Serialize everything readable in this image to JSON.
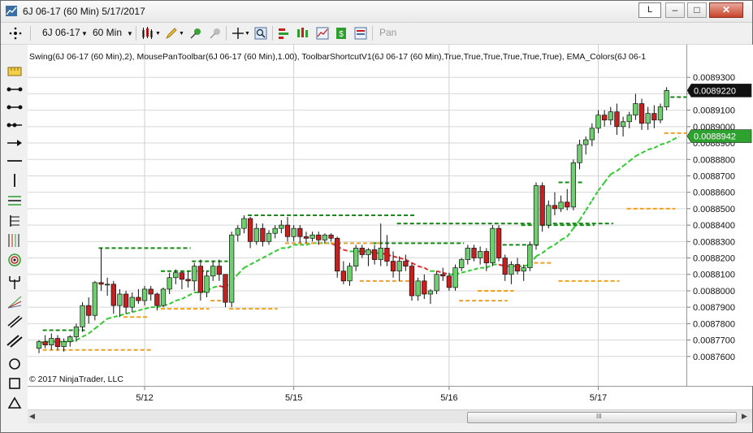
{
  "window": {
    "title": "6J 06-17 (60 Min)  5/17/2017",
    "link_label": "L"
  },
  "toolbar": {
    "instrument": "6J 06-17",
    "interval": "60 Min",
    "pan_label": "Pan"
  },
  "chart_header": {
    "indicators": "Swing(6J 06-17 (60 Min),2), MousePanToolbar(6J 06-17 (60 Min),1.00), ToolbarShortcutV1(6J 06-17 (60 Min),True,True,True,True,True,True), EMA_Colors(6J 06-1"
  },
  "copyright": "© 2017 NinjaTrader, LLC",
  "price_scale": {
    "labels": [
      "0.0089300",
      "0.0089200",
      "0.0089100",
      "0.0089000",
      "0.0088900",
      "0.0088800",
      "0.0088700",
      "0.0088600",
      "0.0088500",
      "0.0088400",
      "0.0088300",
      "0.0088200",
      "0.0088100",
      "0.0088000",
      "0.0087900",
      "0.0087800",
      "0.0087700",
      "0.0087600"
    ],
    "last_price": "0.0089220",
    "ema_value": "0.0088942"
  },
  "time_axis": {
    "labels": [
      "5/12",
      "5/15",
      "5/16",
      "5/17"
    ]
  },
  "colors": {
    "up": "#6fce6f",
    "down": "#c81e1e",
    "ema_up": "#2ecc2e",
    "ema_down": "#e03030",
    "swing_high": "#138b13",
    "swing_low": "#f0a020"
  },
  "chart_data": {
    "type": "candlestick",
    "y_range": [
      0.00875,
      0.00894
    ],
    "bars": [
      [
        0.008765,
        0.00877,
        0.008762,
        0.008769
      ],
      [
        0.008769,
        0.008773,
        0.008765,
        0.008767
      ],
      [
        0.008767,
        0.008774,
        0.008764,
        0.008771
      ],
      [
        0.008771,
        0.008773,
        0.008764,
        0.008766
      ],
      [
        0.008766,
        0.008771,
        0.008763,
        0.008769
      ],
      [
        0.008769,
        0.008773,
        0.008766,
        0.008772
      ],
      [
        0.008772,
        0.00878,
        0.008769,
        0.008778
      ],
      [
        0.008778,
        0.008793,
        0.008775,
        0.008791
      ],
      [
        0.008791,
        0.008796,
        0.00878,
        0.008785
      ],
      [
        0.008785,
        0.008806,
        0.008782,
        0.008805
      ],
      [
        0.008805,
        0.008826,
        0.0088,
        0.008804
      ],
      [
        0.008804,
        0.008808,
        0.008797,
        0.008804
      ],
      [
        0.008804,
        0.008806,
        0.008786,
        0.008791
      ],
      [
        0.008791,
        0.008801,
        0.008784,
        0.008798
      ],
      [
        0.008798,
        0.0088,
        0.008786,
        0.00879
      ],
      [
        0.00879,
        0.008799,
        0.008787,
        0.008796
      ],
      [
        0.008796,
        0.008801,
        0.008792,
        0.008794
      ],
      [
        0.008794,
        0.008803,
        0.008791,
        0.008801
      ],
      [
        0.008801,
        0.008803,
        0.008794,
        0.008798
      ],
      [
        0.008798,
        0.008799,
        0.008788,
        0.008791
      ],
      [
        0.008791,
        0.008802,
        0.00879,
        0.008801
      ],
      [
        0.008801,
        0.008811,
        0.008798,
        0.008808
      ],
      [
        0.008808,
        0.008813,
        0.008804,
        0.008811
      ],
      [
        0.008811,
        0.008812,
        0.008801,
        0.008807
      ],
      [
        0.008807,
        0.008812,
        0.008802,
        0.008806
      ],
      [
        0.008806,
        0.008817,
        0.0088,
        0.008815
      ],
      [
        0.008815,
        0.008819,
        0.008794,
        0.008799
      ],
      [
        0.008799,
        0.008812,
        0.008796,
        0.008809
      ],
      [
        0.008809,
        0.008818,
        0.008806,
        0.008815
      ],
      [
        0.008815,
        0.008819,
        0.008806,
        0.00881
      ],
      [
        0.00881,
        0.00881,
        0.00879,
        0.008793
      ],
      [
        0.008793,
        0.008836,
        0.00879,
        0.008834
      ],
      [
        0.008834,
        0.00884,
        0.00883,
        0.008838
      ],
      [
        0.008838,
        0.008846,
        0.008835,
        0.008844
      ],
      [
        0.008844,
        0.008845,
        0.008826,
        0.00883
      ],
      [
        0.00883,
        0.008841,
        0.008828,
        0.008838
      ],
      [
        0.008838,
        0.008841,
        0.008827,
        0.00883
      ],
      [
        0.00883,
        0.008837,
        0.008828,
        0.008835
      ],
      [
        0.008835,
        0.00884,
        0.008832,
        0.008838
      ],
      [
        0.008838,
        0.008843,
        0.008835,
        0.00884
      ],
      [
        0.00884,
        0.008845,
        0.00883,
        0.008833
      ],
      [
        0.008833,
        0.00884,
        0.00883,
        0.008838
      ],
      [
        0.008838,
        0.00884,
        0.008829,
        0.008833
      ],
      [
        0.008833,
        0.008836,
        0.008829,
        0.008832
      ],
      [
        0.008832,
        0.008836,
        0.00883,
        0.008834
      ],
      [
        0.008834,
        0.008836,
        0.008828,
        0.008831
      ],
      [
        0.008831,
        0.008835,
        0.008829,
        0.008834
      ],
      [
        0.008834,
        0.008835,
        0.00883,
        0.008832
      ],
      [
        0.008832,
        0.008833,
        0.008808,
        0.008812
      ],
      [
        0.008812,
        0.008818,
        0.008804,
        0.008806
      ],
      [
        0.008806,
        0.008817,
        0.008803,
        0.008815
      ],
      [
        0.008815,
        0.008828,
        0.008812,
        0.008826
      ],
      [
        0.008826,
        0.008828,
        0.00882,
        0.008822
      ],
      [
        0.008822,
        0.008826,
        0.008815,
        0.008825
      ],
      [
        0.008825,
        0.008828,
        0.008816,
        0.008819
      ],
      [
        0.008819,
        0.008841,
        0.008815,
        0.008826
      ],
      [
        0.008826,
        0.008834,
        0.008815,
        0.008818
      ],
      [
        0.008818,
        0.008824,
        0.008808,
        0.008812
      ],
      [
        0.008812,
        0.008821,
        0.008806,
        0.008818
      ],
      [
        0.008818,
        0.008822,
        0.008812,
        0.008815
      ],
      [
        0.008815,
        0.008817,
        0.008794,
        0.008797
      ],
      [
        0.008797,
        0.008808,
        0.008794,
        0.008806
      ],
      [
        0.008806,
        0.00881,
        0.008795,
        0.008798
      ],
      [
        0.008798,
        0.008801,
        0.008792,
        0.0088
      ],
      [
        0.0088,
        0.008812,
        0.008798,
        0.00881
      ],
      [
        0.00881,
        0.008814,
        0.008806,
        0.008809
      ],
      [
        0.008809,
        0.008811,
        0.0088,
        0.008802
      ],
      [
        0.008802,
        0.008816,
        0.0088,
        0.008814
      ],
      [
        0.008814,
        0.00882,
        0.008812,
        0.008819
      ],
      [
        0.008819,
        0.008828,
        0.008816,
        0.008826
      ],
      [
        0.008826,
        0.008828,
        0.008818,
        0.00882
      ],
      [
        0.00882,
        0.008827,
        0.008816,
        0.008824
      ],
      [
        0.008824,
        0.008826,
        0.008812,
        0.008817
      ],
      [
        0.008817,
        0.00884,
        0.008815,
        0.008838
      ],
      [
        0.008838,
        0.00884,
        0.008818,
        0.00882
      ],
      [
        0.00882,
        0.008822,
        0.008806,
        0.00881
      ],
      [
        0.00881,
        0.008818,
        0.008804,
        0.008816
      ],
      [
        0.008816,
        0.00882,
        0.00881,
        0.008812
      ],
      [
        0.008812,
        0.008816,
        0.008806,
        0.008814
      ],
      [
        0.008814,
        0.00883,
        0.008812,
        0.008828
      ],
      [
        0.008828,
        0.008866,
        0.008825,
        0.008864
      ],
      [
        0.008864,
        0.008866,
        0.008836,
        0.00884
      ],
      [
        0.00884,
        0.008855,
        0.008838,
        0.008852
      ],
      [
        0.008852,
        0.00886,
        0.008846,
        0.00885
      ],
      [
        0.00885,
        0.008858,
        0.008848,
        0.008854
      ],
      [
        0.008854,
        0.008862,
        0.008849,
        0.008851
      ],
      [
        0.008851,
        0.00888,
        0.008849,
        0.008878
      ],
      [
        0.008878,
        0.008892,
        0.008874,
        0.008889
      ],
      [
        0.008889,
        0.008894,
        0.008883,
        0.008892
      ],
      [
        0.008892,
        0.008902,
        0.008888,
        0.008899
      ],
      [
        0.008899,
        0.00891,
        0.008896,
        0.008907
      ],
      [
        0.008907,
        0.00891,
        0.0089,
        0.008904
      ],
      [
        0.008904,
        0.008912,
        0.008901,
        0.008909
      ],
      [
        0.008909,
        0.008914,
        0.008895,
        0.0089
      ],
      [
        0.0089,
        0.008906,
        0.008894,
        0.008903
      ],
      [
        0.008903,
        0.008909,
        0.008899,
        0.008907
      ],
      [
        0.008907,
        0.00892,
        0.008904,
        0.008914
      ],
      [
        0.008914,
        0.008917,
        0.008898,
        0.008902
      ],
      [
        0.008902,
        0.008912,
        0.008898,
        0.008908
      ],
      [
        0.008908,
        0.008913,
        0.008899,
        0.008904
      ],
      [
        0.008904,
        0.008914,
        0.008902,
        0.008912
      ],
      [
        0.008912,
        0.008924,
        0.00891,
        0.008922
      ]
    ],
    "swing_highs": [
      [
        1,
        7,
        0.008776
      ],
      [
        10,
        24,
        0.008826
      ],
      [
        20,
        27,
        0.008812
      ],
      [
        25,
        30,
        0.008818
      ],
      [
        34,
        60,
        0.008846
      ],
      [
        54,
        68,
        0.008829
      ],
      [
        58,
        92,
        0.008841
      ],
      [
        75,
        80,
        0.008828
      ],
      [
        78,
        89,
        0.00884
      ],
      [
        84,
        87,
        0.008866
      ],
      [
        102,
        105,
        0.008918
      ]
    ],
    "swing_lows": [
      [
        1,
        18,
        0.008764
      ],
      [
        14,
        17,
        0.008784
      ],
      [
        20,
        27,
        0.008789
      ],
      [
        28,
        30,
        0.008794
      ],
      [
        31,
        38,
        0.008789
      ],
      [
        40,
        55,
        0.008829
      ],
      [
        52,
        60,
        0.008806
      ],
      [
        68,
        75,
        0.008794
      ],
      [
        71,
        76,
        0.0088
      ],
      [
        79,
        82,
        0.008817
      ],
      [
        84,
        93,
        0.008806
      ],
      [
        95,
        102,
        0.00885
      ],
      [
        101,
        105,
        0.008896
      ]
    ],
    "ema": [
      0.008768,
      0.008769,
      0.008769,
      0.008769,
      0.008769,
      0.008769,
      0.00877,
      0.008772,
      0.008774,
      0.008777,
      0.00878,
      0.008783,
      0.008784,
      0.008785,
      0.008786,
      0.008787,
      0.008788,
      0.008789,
      0.00879,
      0.00879,
      0.008791,
      0.008792,
      0.008794,
      0.008795,
      0.008797,
      0.008799,
      0.008799,
      0.0088,
      0.008802,
      0.008803,
      0.008802,
      0.008806,
      0.00881,
      0.008814,
      0.008816,
      0.008818,
      0.00882,
      0.008822,
      0.008824,
      0.008826,
      0.008826,
      0.008828,
      0.008828,
      0.008828,
      0.008829,
      0.008829,
      0.008829,
      0.008829,
      0.008827,
      0.008825,
      0.008824,
      0.008824,
      0.008824,
      0.008824,
      0.008823,
      0.008823,
      0.008822,
      0.008821,
      0.00882,
      0.008819,
      0.008817,
      0.008815,
      0.008814,
      0.008812,
      0.008812,
      0.008811,
      0.00881,
      0.00881,
      0.008811,
      0.008812,
      0.008813,
      0.008814,
      0.008814,
      0.008816,
      0.008816,
      0.008815,
      0.008815,
      0.008815,
      0.008815,
      0.008816,
      0.008821,
      0.008823,
      0.008826,
      0.008828,
      0.008831,
      0.008833,
      0.008838,
      0.008843,
      0.008849,
      0.008855,
      0.008861,
      0.008866,
      0.008871,
      0.008873,
      0.008876,
      0.008879,
      0.008882,
      0.008884,
      0.008886,
      0.008887,
      0.008889,
      0.00889,
      0.008892,
      0.008894
    ]
  }
}
